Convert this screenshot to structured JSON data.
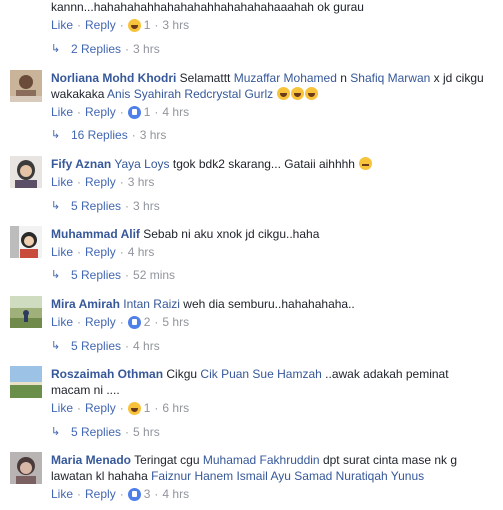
{
  "top": {
    "text": "kannn...hahahahahhahahahahhahahahahaaahah ok gurau",
    "actions": {
      "like": "Like",
      "reply": "Reply",
      "react_count": "1",
      "time": "3 hrs"
    },
    "replies": {
      "count": "2 Replies",
      "time": "3 hrs"
    }
  },
  "comments": [
    {
      "author": "Norliana Mohd Khodri",
      "text_before": "Selamattt",
      "tag1": "Muzaffar Mohamed",
      "mid1": "n",
      "tag2": "Shafiq Marwan",
      "mid2": "x jd cikgu wakakaka",
      "tag3": "Anis Syahirah Redcrystal Gurlz",
      "actions": {
        "like": "Like",
        "reply": "Reply",
        "react_count": "1",
        "time": "4 hrs"
      },
      "replies": {
        "count": "16 Replies",
        "time": "3 hrs"
      }
    },
    {
      "author": "Fify Aznan",
      "tag1": "Yaya Loys",
      "text": "tgok bdk2 skarang... Gataii aihhhh",
      "actions": {
        "like": "Like",
        "reply": "Reply",
        "time": "3 hrs"
      },
      "replies": {
        "count": "5 Replies",
        "time": "3 hrs"
      }
    },
    {
      "author": "Muhammad Alif",
      "text": "Sebab ni aku xnok jd cikgu..haha",
      "actions": {
        "like": "Like",
        "reply": "Reply",
        "time": "4 hrs"
      },
      "replies": {
        "count": "5 Replies",
        "time": "52 mins"
      }
    },
    {
      "author": "Mira Amirah",
      "tag1": "Intan Raizi",
      "text": "weh dia semburu..hahahahaha..",
      "actions": {
        "like": "Like",
        "reply": "Reply",
        "react_count": "2",
        "time": "5 hrs"
      },
      "replies": {
        "count": "5 Replies",
        "time": "4 hrs"
      }
    },
    {
      "author": "Roszaimah Othman",
      "text_before": "Cikgu",
      "tag1": "Cik Puan Sue Hamzah",
      "text": "..awak adakah peminat macam ni ....",
      "actions": {
        "like": "Like",
        "reply": "Reply",
        "react_count": "1",
        "time": "6 hrs"
      },
      "replies": {
        "count": "5 Replies",
        "time": "5 hrs"
      }
    },
    {
      "author": "Maria Menado",
      "text_before": "Teringat cgu",
      "tag1": "Muhamad Fakhruddin",
      "text": "dpt surat cinta mase nk g lawatan kl hahaha",
      "tag2": "Faiznur Hanem Ismail",
      "tag3": "Ayu Samad",
      "tag4": "Nuratiqah Yunus",
      "actions": {
        "like": "Like",
        "reply": "Reply",
        "react_count": "3",
        "time": "4 hrs"
      }
    }
  ],
  "colors": {
    "link": "#365899",
    "action": "#4267b2",
    "meta": "#90949c",
    "text": "#1d2129"
  }
}
